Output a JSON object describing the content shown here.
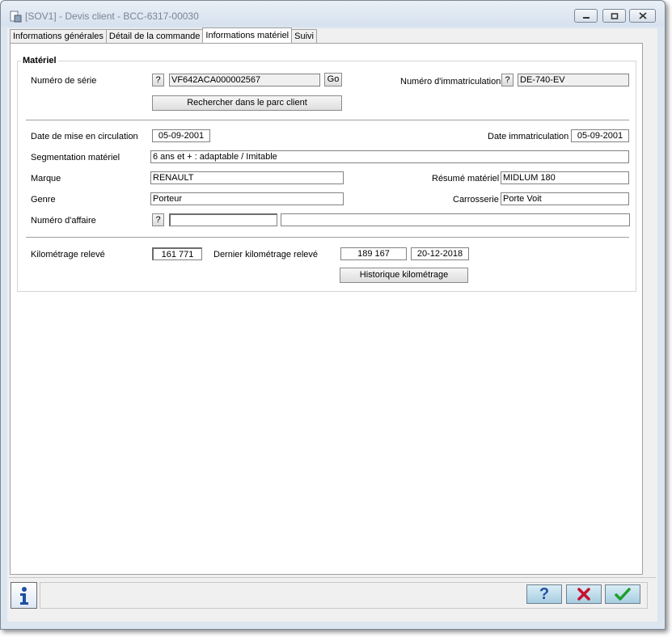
{
  "window": {
    "title": "[SOV1] - Devis client - BCC-6317-00030"
  },
  "tabs": [
    {
      "label": "Informations générales"
    },
    {
      "label": "Détail de la commande"
    },
    {
      "label": "Informations matériel"
    },
    {
      "label": "Suivi"
    }
  ],
  "materiel": {
    "group_title": "Matériel",
    "numero_serie_label": "Numéro de série",
    "help_symbol": "?",
    "numero_serie_value": "VF642ACA000002567",
    "go_label": "Go",
    "numero_immat_label": "Numéro d'immatriculation",
    "numero_immat_value": "DE-740-EV",
    "rechercher_label": "Rechercher dans le parc client",
    "date_mise_circ_label": "Date de mise en circulation",
    "date_mise_circ_value": "05-09-2001",
    "date_immat_label": "Date immatriculation",
    "date_immat_value": "05-09-2001",
    "segmentation_label": "Segmentation matériel",
    "segmentation_value": "6 ans et + : adaptable / Imitable",
    "marque_label": "Marque",
    "marque_value": "RENAULT",
    "resume_label": "Résumé matériel",
    "resume_value": "MIDLUM 180",
    "genre_label": "Genre",
    "genre_value": "Porteur",
    "carrosserie_label": "Carrosserie",
    "carrosserie_value": "Porte Voit",
    "numero_affaire_label": "Numéro d'affaire",
    "numero_affaire_value": "",
    "numero_affaire_desc": "",
    "km_releve_label": "Kilométrage relevé",
    "km_releve_value": "161 771",
    "dernier_km_label": "Dernier kilométrage relevé",
    "dernier_km_value": "189 167",
    "dernier_km_date": "20-12-2018",
    "historique_label": "Historique kilométrage"
  },
  "statusbar": {
    "help_symbol": "?",
    "status_text": ""
  },
  "colors": {
    "window_bg": "#dce6f0",
    "cancel_red": "#c8102e",
    "ok_green": "#1e9e2a",
    "help_blue": "#1f4fa3"
  }
}
